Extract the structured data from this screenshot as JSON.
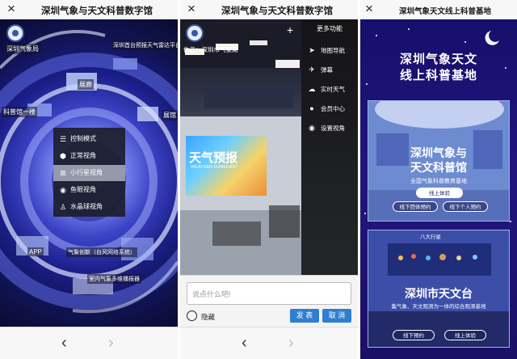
{
  "panels": {
    "vr_menu": {
      "title": "深圳气象与天文科普数字馆",
      "hotspots": [
        "深圳气象局",
        "深圳首台预报天气雷达平台",
        "科普馆一楼",
        "展廊",
        "展馆",
        "APP",
        "气象创新（台风网络系统）",
        "室内气象多维播报器"
      ],
      "control_menu": {
        "items": [
          {
            "icon": "sliders-icon",
            "label": "控制模式"
          },
          {
            "icon": "cube-icon",
            "label": "正常视角"
          },
          {
            "icon": "globe-icon",
            "label": "小行星视角"
          },
          {
            "icon": "fisheye-icon",
            "label": "鱼眼视角"
          },
          {
            "icon": "crystal-ball-icon",
            "label": "水晶球视角"
          }
        ],
        "selected": "小行星视角"
      }
    },
    "studio": {
      "title": "深圳气象与天文科普数字馆",
      "author": "作者：深圳市气象局",
      "screen_text": "天气预报",
      "screen_subtext": "WEATHER FORECAST",
      "plus_label": "+",
      "side_menu": {
        "title": "更多功能",
        "items": [
          {
            "icon": "navigation-icon",
            "label": "地图导航"
          },
          {
            "icon": "send-icon",
            "label": "弹幕"
          },
          {
            "icon": "cloud-icon",
            "label": "实时天气"
          },
          {
            "icon": "user-icon",
            "label": "会员中心"
          },
          {
            "icon": "eye-icon",
            "label": "设置视角"
          }
        ]
      },
      "comment_placeholder": "说点什么吧!",
      "hide_label": "隐藏",
      "send_label": "发 表",
      "cancel_label": "取 消"
    },
    "base": {
      "title": "深圳气象天文线上科普基地",
      "headline_1": "深圳气象天文",
      "headline_2": "线上科普基地",
      "card1": {
        "name_1": "深圳气象与",
        "name_2": "天文科普馆",
        "subtitle": "全国气象科普教育基地",
        "btn_online": "线上体验",
        "btn_group": "线下团体预约",
        "btn_personal": "线下个人预约"
      },
      "card2": {
        "sign": "八大行星",
        "name": "深圳市天文台",
        "subtitle_1": "集气象、天文观测为一体的综合观测基地",
        "btn_offline": "线下预约",
        "btn_online": "线上体验"
      }
    }
  },
  "nav": {
    "back": "‹",
    "forward": "›"
  },
  "colors": {
    "accent_blue": "#2f7fd1",
    "menu_bg": "#1c1e2c",
    "card_blue": "#6c8bd0",
    "p3_bg": "#1a1066"
  }
}
